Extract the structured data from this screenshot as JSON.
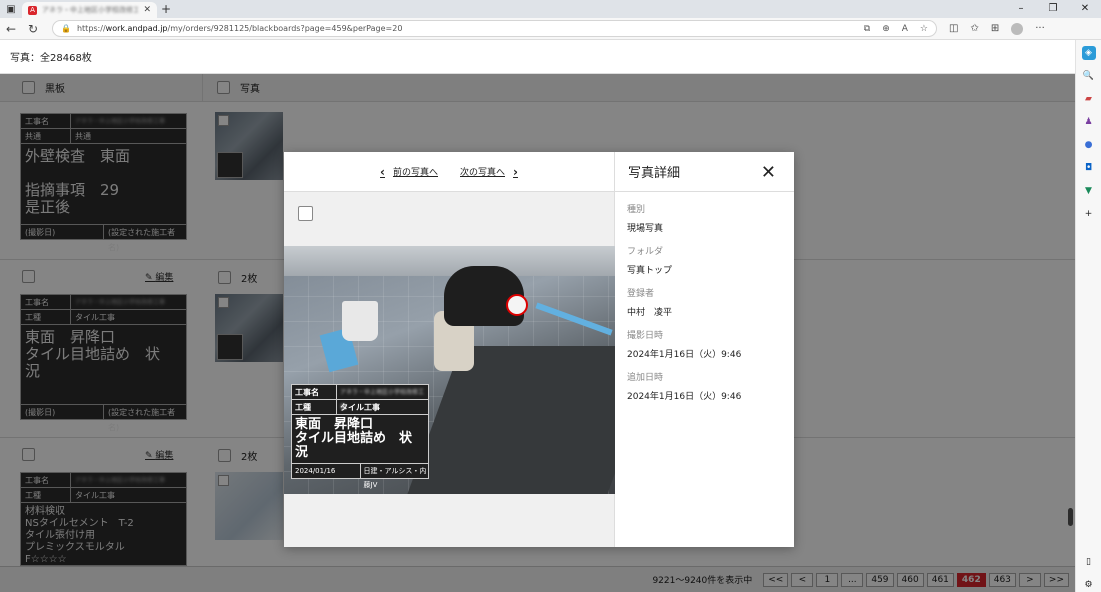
{
  "browser": {
    "url_prefix": "https://",
    "url_host": "work.andpad.jp",
    "url_path": "/my/orders/9281125/blackboards?page=459&perPage=20",
    "tab_title": "アネラ・中上地区小学校改修工事"
  },
  "page": {
    "header": "写真：全28468枚",
    "columns": {
      "blackboard": "黒板",
      "photo": "写真"
    }
  },
  "rows": [
    {
      "edit": "",
      "count": "",
      "board": {
        "row1_key": "工事名",
        "row1_val": "アネラ・中上地区小学校改修工事",
        "row2_key": "共通",
        "row2_val": "共通",
        "text": "外壁検査　東面\n\n指摘事項　29\n是正後",
        "foot_left": "(撮影日)",
        "foot_right": "(設定された施工者名)"
      }
    },
    {
      "edit": "編集",
      "count": "2枚",
      "board": {
        "row1_key": "工事名",
        "row1_val": "アネラ・中上地区小学校改修工事",
        "row2_key": "工種",
        "row2_val": "タイル工事",
        "text": "東面　昇降口\nタイル目地詰め　状\n況",
        "foot_left": "(撮影日)",
        "foot_right": "(設定された施工者名)"
      }
    },
    {
      "edit": "編集",
      "count": "2枚",
      "board": {
        "row1_key": "工事名",
        "row1_val": "アネラ・中上地区小学校改修工事",
        "row2_key": "工種",
        "row2_val": "タイル工事",
        "text": "材料検収\nNSタイルセメント　T-2\nタイル張付け用\nプレミックスモルタル\nF☆☆☆☆"
      }
    }
  ],
  "pager": {
    "info": "9221〜9240件を表示中",
    "buttons": [
      "<<",
      "<",
      "1",
      "...",
      "459",
      "460",
      "461",
      "462",
      "463",
      ">",
      ">>"
    ],
    "current": "462"
  },
  "modal": {
    "prev": "前の写真へ",
    "next": "次の写真へ",
    "title": "写真詳細",
    "fields": [
      {
        "label": "種別",
        "value": "現場写真"
      },
      {
        "label": "フォルダ",
        "value": "写真トップ"
      },
      {
        "label": "登録者",
        "value": "中村　凌平"
      },
      {
        "label": "撮影日時",
        "value": "2024年1月16日（火）9:46"
      },
      {
        "label": "追加日時",
        "value": "2024年1月16日（火）9:46"
      }
    ],
    "photo_board": {
      "row1_key": "工事名",
      "row1_val": "アネラ・中上地区小学校改修工事",
      "row2_key": "工種",
      "row2_val": "タイル工事",
      "text": "東面　昇降口\nタイル目地詰め　状\n況",
      "date": "2024/01/16",
      "company": "日建・アルシス・内藤JV"
    }
  },
  "colors": {
    "current_page": "#d9262c",
    "overlay": "rgba(0,0,0,0.48)"
  }
}
